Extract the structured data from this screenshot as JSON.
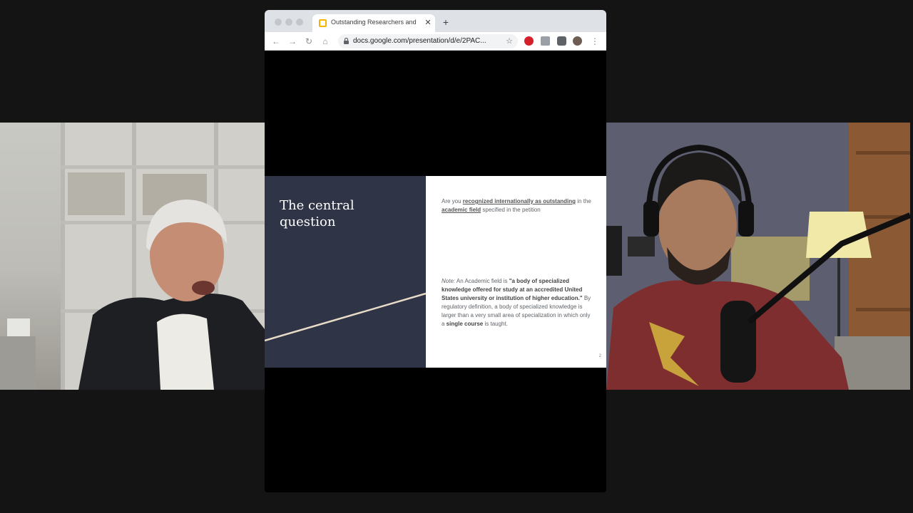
{
  "browser": {
    "tab_title": "Outstanding Researchers and",
    "tab_close": "✕",
    "new_tab": "+",
    "url": "docs.google.com/presentation/d/e/2PAC...",
    "nav": {
      "back": "←",
      "forward": "→",
      "reload": "↻",
      "home": "⌂"
    },
    "star": "☆",
    "menu": "⋮",
    "extension_icons": [
      "opera-icon",
      "translate-icon",
      "puzzle-icon",
      "profile-avatar"
    ]
  },
  "slide": {
    "title": "The central question",
    "p1": {
      "t1": "Are you ",
      "u1": "recognized internationally as outstanding",
      "t2": " in the ",
      "u2": "academic field",
      "t3": " specified in the petition"
    },
    "p2": {
      "note": "Note:",
      "t1": "  An Academic field is ",
      "b1": "\"a body of specialized knowledge offered for study at an accredited United States university or institution of higher education.\"",
      "t2": " By regulatory definition, a body of specialized knowledge is larger than a very small area of specialization in which only a ",
      "b2": "single course",
      "t3": " is taught."
    },
    "page_number": "2"
  },
  "colors": {
    "background": "#141414",
    "slide_panel": "#2f3446",
    "slide_line": "#e8dcc8",
    "tab_favicon": "#f4b400"
  }
}
